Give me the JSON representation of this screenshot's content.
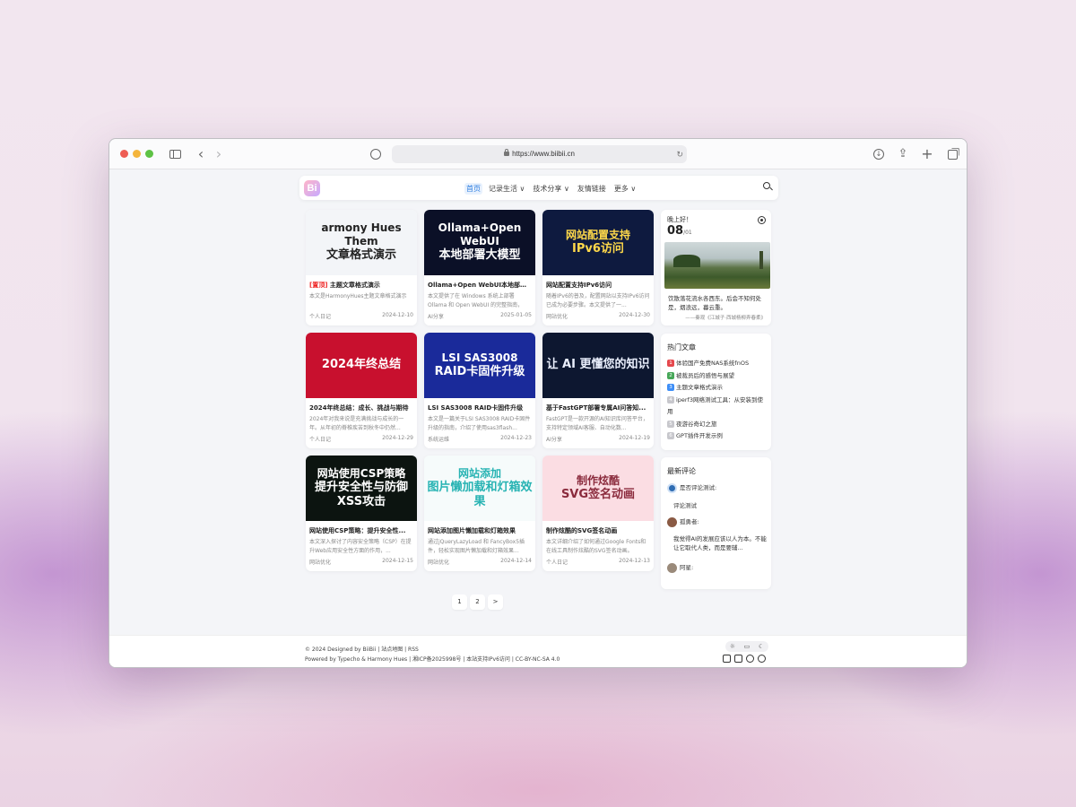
{
  "browser": {
    "url": "https://www.biibii.cn"
  },
  "nav": {
    "logo": "Bi",
    "items": [
      "首页",
      "记录生活",
      "技术分享",
      "友情链接",
      "更多"
    ],
    "dropdown_marks": [
      "∨",
      "∨",
      "∨"
    ]
  },
  "cards": [
    {
      "img_text": "文章格式演示",
      "img_sub": "armony Hues Them",
      "img_bg": "#f3f5f8",
      "img_color": "#222",
      "pin": "[置顶]",
      "title": "主题文章格式演示",
      "desc": "本文是HarmonyHues主题文章格式演示",
      "category": "个人日记",
      "date": "2024-12-10"
    },
    {
      "img_text": "本地部署大模型",
      "img_sub": "Ollama+Open WebUI",
      "img_bg": "#0b1027",
      "img_color": "#ffffff",
      "pin": "",
      "title": "Ollama+Open WebUI本地部署...",
      "desc": "本文提供了在 Windows 系统上部署 Ollama 和 Open WebUI 的完整指南，",
      "category": "AI分享",
      "date": "2025-01-05"
    },
    {
      "img_text": "IPv6访问",
      "img_sub": "网站配置支持",
      "img_bg": "#0e1a3f",
      "img_color": "#ffd94a",
      "pin": "",
      "title": "网站配置支持IPv6访问",
      "desc": "随着IPv6的普及，配置网站以支持IPv6访问已成为必要步骤。本文提供了一...",
      "category": "网站优化",
      "date": "2024-12-30"
    },
    {
      "img_text": "2024年终总结",
      "img_sub": "",
      "img_bg": "#c8102e",
      "img_color": "#ffffff",
      "pin": "",
      "title": "2024年终总结：成长、挑战与期待",
      "desc": "2024年对我来说是充满挑战与成长的一年。从年初的脊椎疾苦到秋冬中仍然...",
      "category": "个人日记",
      "date": "2024-12-29"
    },
    {
      "img_text": "RAID卡固件升级",
      "img_sub": "LSI SAS3008",
      "img_bg": "#1a2a9a",
      "img_color": "#ffffff",
      "pin": "",
      "title": "LSI SAS3008 RAID卡固件升级",
      "desc": "本文是一篇关于LSI SAS3008 RAID卡固件升级的指南，介绍了使用sas3flash...",
      "category": "系统运维",
      "date": "2024-12-23"
    },
    {
      "img_text": "让 AI 更懂您的知识",
      "img_sub": "",
      "img_bg": "#0d1730",
      "img_color": "#e9eefc",
      "pin": "",
      "title": "基于FastGPT部署专属AI问答知...",
      "desc": "FastGPT是一款开源的AI知识库问答平台，支持特定领域AI客服、自动化数...",
      "category": "AI分享",
      "date": "2024-12-19"
    },
    {
      "img_text": "提升安全性与防御XSS攻击",
      "img_sub": "网站使用CSP策略",
      "img_bg": "#0c1410",
      "img_color": "#ffffff",
      "pin": "",
      "title": "网站使用CSP策略：提升安全性...",
      "desc": "本文深入探讨了内容安全策略（CSP）在提升Web应用安全性方面的作用，...",
      "category": "网站优化",
      "date": "2024-12-15"
    },
    {
      "img_text": "图片懒加载和灯箱效果",
      "img_sub": "网站添加",
      "img_bg": "#f6fbfb",
      "img_color": "#27b3b3",
      "pin": "",
      "title": "网站添加图片懒加载和灯箱效果",
      "desc": "通过jQueryLazyLoad 和 FancyBox5插件，轻松实现图片懒加载和灯箱效果...",
      "category": "网站优化",
      "date": "2024-12-14"
    },
    {
      "img_text": "SVG签名动画",
      "img_sub": "制作炫酷",
      "img_bg": "#fbdde3",
      "img_color": "#8a2a3c",
      "pin": "",
      "title": "制作炫酷的SVG签名动画",
      "desc": "本文详细介绍了如何通过Google Fonts和在线工具制作炫酷的SVG签名动画。",
      "category": "个人日记",
      "date": "2024-12-13"
    }
  ],
  "side_weather": {
    "greeting": "晚上好！",
    "day": "08",
    "month": "/01",
    "quote": "饮散落花流水各西东。后会不知何处是，烟浪远，暮云重。",
    "source": "——秦观《江城子·西城杨柳弄春柔》"
  },
  "hot": {
    "heading": "热门文章",
    "items": [
      {
        "rank": "1",
        "color": "#e5484d",
        "title": "体验国产免费NAS系统fnOS"
      },
      {
        "rank": "2",
        "color": "#46a758",
        "title": "被裁员后的感悟与展望"
      },
      {
        "rank": "3",
        "color": "#3e8ef7",
        "title": "主题文章格式演示"
      },
      {
        "rank": "4",
        "color": "#c7c7cc",
        "title": "iperf3网络测试工具：从安装到使用"
      },
      {
        "rank": "5",
        "color": "#c7c7cc",
        "title": "夜游谷奇幻之旅"
      },
      {
        "rank": "6",
        "color": "#c7c7cc",
        "title": "GPT插件开发示例"
      }
    ]
  },
  "comments": {
    "heading": "最新评论",
    "items": [
      {
        "author": "是否评论测试:",
        "text": "评论测试",
        "avatar_color": "#2f6db3"
      },
      {
        "author": "孤勇者:",
        "text": "我觉得AI的发展应该以人为本。不能让它取代人类，而是要辅...",
        "avatar_color": "#8a5a44"
      },
      {
        "author": "阿星:",
        "text": "",
        "avatar_color": "#9a8a7a"
      }
    ]
  },
  "pager": [
    "1",
    "2",
    ">"
  ],
  "footer": {
    "line1": "© 2024 Designed by BiiBii | 站点地图 | RSS",
    "line2": "Powered by Typecho & Harmony Hues | 湘ICP备2025998号 | 本站支持IPv6访问 | CC-BY-NC-SA 4.0",
    "theme_icons": [
      "☼",
      "▭",
      "☾"
    ]
  }
}
